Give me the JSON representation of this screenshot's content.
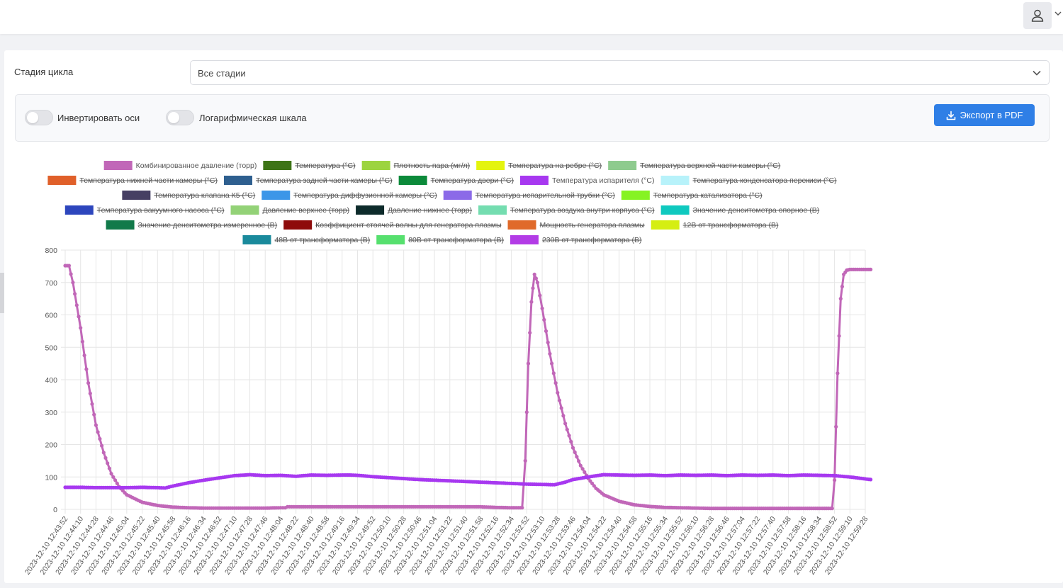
{
  "header": {
    "user_icon": "user-icon",
    "caret_icon": "chevron-down-icon"
  },
  "filter": {
    "label": "Стадия цикла",
    "select_value": "Все стадии"
  },
  "toolbar": {
    "invert_axes_label": "Инвертировать оси",
    "log_scale_label": "Логарифмическая шкала",
    "invert_axes_on": false,
    "log_scale_on": false,
    "export_label": "Экспорт в PDF",
    "accent_color": "#2f7fe6"
  },
  "chart_data": {
    "type": "line",
    "ylim": [
      0,
      800
    ],
    "yticks": [
      "800",
      "700",
      "600",
      "500",
      "400",
      "300",
      "200",
      "100",
      "0"
    ],
    "legend_rows": [
      [
        {
          "name": "Комбинированное давление (торр)",
          "color": "#c167b8",
          "hidden": false
        },
        {
          "name": "Температура (°С)",
          "color": "#3e7417",
          "hidden": true
        },
        {
          "name": "Плотность пара (мг/л)",
          "color": "#9cd43f",
          "hidden": true
        },
        {
          "name": "Температура на ребре (°С)",
          "color": "#e4f40e",
          "hidden": true
        },
        {
          "name": "Температура верхней части камеры (°С)",
          "color": "#8ecb8e",
          "hidden": true
        }
      ],
      [
        {
          "name": "Температура нижней части камеры (°С)",
          "color": "#e0602a",
          "hidden": true
        },
        {
          "name": "Температура задней части камеры (°С)",
          "color": "#2e5f8f",
          "hidden": true
        },
        {
          "name": "Температура двери (°С)",
          "color": "#0c8a3a",
          "hidden": true
        },
        {
          "name": "Температура испарителя (°С)",
          "color": "#a738f0",
          "hidden": false
        },
        {
          "name": "Температура конденсатора перекиси (°С)",
          "color": "#b7f2fa",
          "hidden": true
        }
      ],
      [
        {
          "name": "Температура клапана К5 (°С)",
          "color": "#463f63",
          "hidden": true
        },
        {
          "name": "Температура диффузионной камеры (°С)",
          "color": "#3c96e8",
          "hidden": true
        },
        {
          "name": "Температура испарительной трубки (°С)",
          "color": "#8b6ae8",
          "hidden": true
        },
        {
          "name": "Температура катализатора (°С)",
          "color": "#86f323",
          "hidden": true
        }
      ],
      [
        {
          "name": "Температура вакуумного насоса (°С)",
          "color": "#2d46bd",
          "hidden": true
        },
        {
          "name": "Давление верхнее (торр)",
          "color": "#93d277",
          "hidden": true
        },
        {
          "name": "Давление нижнее (торр)",
          "color": "#0d2b2b",
          "hidden": true
        },
        {
          "name": "Температура воздуха внутри корпуса (°С)",
          "color": "#74ddb0",
          "hidden": true
        },
        {
          "name": "Значение денситометра опорное (В)",
          "color": "#0fc9bf",
          "hidden": true
        }
      ],
      [
        {
          "name": "Значение денситометра измеренное (В)",
          "color": "#117a4a",
          "hidden": true
        },
        {
          "name": "Коэффициент стоячей волны для генератора плазмы",
          "color": "#8e0b0b",
          "hidden": true
        },
        {
          "name": "Мощность генератора плазмы",
          "color": "#e06a2a",
          "hidden": true
        },
        {
          "name": "12В от трансформатора (В)",
          "color": "#d5ee12",
          "hidden": true
        }
      ],
      [
        {
          "name": "48В от трансформатора (В)",
          "color": "#1a8a9c",
          "hidden": true
        },
        {
          "name": "80В от трансформатора (В)",
          "color": "#56e06e",
          "hidden": true
        },
        {
          "name": "230В от трансформатора (В)",
          "color": "#b33ce6",
          "hidden": true
        }
      ]
    ],
    "categories": [
      "2023-12-10 12:43:52",
      "2023-12-10 12:44:10",
      "2023-12-10 12:44:28",
      "2023-12-10 12:44:46",
      "2023-12-10 12:45:04",
      "2023-12-10 12:45:22",
      "2023-12-10 12:45:40",
      "2023-12-10 12:45:58",
      "2023-12-10 12:46:16",
      "2023-12-10 12:46:34",
      "2023-12-10 12:46:52",
      "2023-12-10 12:47:10",
      "2023-12-10 12:47:28",
      "2023-12-10 12:47:46",
      "2023-12-10 12:48:04",
      "2023-12-10 12:48:22",
      "2023-12-10 12:48:40",
      "2023-12-10 12:48:58",
      "2023-12-10 12:49:16",
      "2023-12-10 12:49:34",
      "2023-12-10 12:49:52",
      "2023-12-10 12:50:10",
      "2023-12-10 12:50:28",
      "2023-12-10 12:50:46",
      "2023-12-10 12:51:04",
      "2023-12-10 12:51:22",
      "2023-12-10 12:51:40",
      "2023-12-10 12:51:58",
      "2023-12-10 12:52:16",
      "2023-12-10 12:52:34",
      "2023-12-10 12:52:52",
      "2023-12-10 12:53:10",
      "2023-12-10 12:53:28",
      "2023-12-10 12:53:46",
      "2023-12-10 12:54:04",
      "2023-12-10 12:54:22",
      "2023-12-10 12:54:40",
      "2023-12-10 12:54:58",
      "2023-12-10 12:55:16",
      "2023-12-10 12:55:34",
      "2023-12-10 12:55:52",
      "2023-12-10 12:56:10",
      "2023-12-10 12:56:28",
      "2023-12-10 12:56:46",
      "2023-12-10 12:57:04",
      "2023-12-10 12:57:22",
      "2023-12-10 12:57:40",
      "2023-12-10 12:57:58",
      "2023-12-10 12:58:16",
      "2023-12-10 12:58:34",
      "2023-12-10 12:58:52",
      "2023-12-10 12:59:10",
      "2023-12-10 12:59:28"
    ],
    "series": [
      {
        "name": "Комбинированное давление (торр)",
        "color": "#c167b8",
        "points": [
          [
            0,
            752
          ],
          [
            0.25,
            752
          ],
          [
            0.5,
            700
          ],
          [
            1,
            560
          ],
          [
            1.5,
            390
          ],
          [
            2,
            260
          ],
          [
            2.5,
            175
          ],
          [
            3,
            110
          ],
          [
            3.5,
            70
          ],
          [
            4,
            45
          ],
          [
            5,
            22
          ],
          [
            6,
            12
          ],
          [
            7,
            7
          ],
          [
            8,
            5
          ],
          [
            9,
            4
          ],
          [
            10,
            4
          ],
          [
            11,
            4
          ],
          [
            12,
            4
          ],
          [
            13,
            4
          ],
          [
            14,
            5
          ],
          [
            14.3,
            5
          ],
          [
            14.45,
            8
          ],
          [
            15,
            8
          ],
          [
            16,
            8
          ],
          [
            17,
            8
          ],
          [
            18,
            8
          ],
          [
            19,
            8
          ],
          [
            20,
            8
          ],
          [
            21,
            8
          ],
          [
            22,
            8
          ],
          [
            23,
            8
          ],
          [
            24,
            8
          ],
          [
            25,
            8
          ],
          [
            26,
            8
          ],
          [
            27,
            8
          ],
          [
            28,
            6
          ],
          [
            29,
            5
          ],
          [
            29.7,
            5
          ],
          [
            29.9,
            150
          ],
          [
            30.1,
            450
          ],
          [
            30.3,
            640
          ],
          [
            30.5,
            725
          ],
          [
            30.7,
            700
          ],
          [
            31,
            620
          ],
          [
            31.5,
            480
          ],
          [
            32,
            360
          ],
          [
            32.5,
            265
          ],
          [
            33,
            190
          ],
          [
            33.5,
            135
          ],
          [
            34,
            95
          ],
          [
            34.5,
            65
          ],
          [
            35,
            45
          ],
          [
            36,
            25
          ],
          [
            37,
            14
          ],
          [
            38,
            9
          ],
          [
            39,
            6
          ],
          [
            40,
            5
          ],
          [
            41,
            4
          ],
          [
            42,
            3
          ],
          [
            43,
            3
          ],
          [
            44,
            3
          ],
          [
            45,
            3
          ],
          [
            46,
            3
          ],
          [
            47,
            3
          ],
          [
            48,
            3
          ],
          [
            49,
            3
          ],
          [
            49.85,
            3
          ],
          [
            50.0,
            90
          ],
          [
            50.2,
            420
          ],
          [
            50.4,
            650
          ],
          [
            50.6,
            725
          ],
          [
            50.8,
            738
          ],
          [
            51,
            740
          ],
          [
            52,
            740
          ],
          [
            52.35,
            740
          ]
        ]
      },
      {
        "name": "Температура испарителя (°С)",
        "color": "#a738f0",
        "points": [
          [
            0,
            68
          ],
          [
            1,
            68
          ],
          [
            2,
            67
          ],
          [
            3,
            67
          ],
          [
            4,
            67
          ],
          [
            5,
            68
          ],
          [
            6,
            67
          ],
          [
            6.5,
            66
          ],
          [
            7,
            72
          ],
          [
            8,
            82
          ],
          [
            9,
            90
          ],
          [
            10,
            97
          ],
          [
            11,
            104
          ],
          [
            12,
            107
          ],
          [
            13,
            104
          ],
          [
            14,
            105
          ],
          [
            15,
            102
          ],
          [
            16,
            106
          ],
          [
            17,
            105
          ],
          [
            18,
            106
          ],
          [
            18.5,
            106
          ],
          [
            19,
            105
          ],
          [
            20,
            101
          ],
          [
            21,
            98
          ],
          [
            22,
            95
          ],
          [
            23,
            92
          ],
          [
            24,
            90
          ],
          [
            25,
            88
          ],
          [
            26,
            86
          ],
          [
            27,
            84
          ],
          [
            28,
            82
          ],
          [
            29,
            80
          ],
          [
            30,
            78
          ],
          [
            31,
            77
          ],
          [
            31.8,
            76
          ],
          [
            32.5,
            84
          ],
          [
            33,
            92
          ],
          [
            34,
            100
          ],
          [
            35,
            107
          ],
          [
            36,
            106
          ],
          [
            37,
            105
          ],
          [
            38,
            106
          ],
          [
            39,
            104
          ],
          [
            40,
            106
          ],
          [
            41,
            105
          ],
          [
            42,
            106
          ],
          [
            43,
            104
          ],
          [
            44,
            106
          ],
          [
            45,
            105
          ],
          [
            46,
            106
          ],
          [
            47,
            104
          ],
          [
            48,
            106
          ],
          [
            49,
            105
          ],
          [
            50,
            104
          ],
          [
            51,
            100
          ],
          [
            52,
            94
          ],
          [
            52.35,
            92
          ]
        ]
      }
    ]
  }
}
